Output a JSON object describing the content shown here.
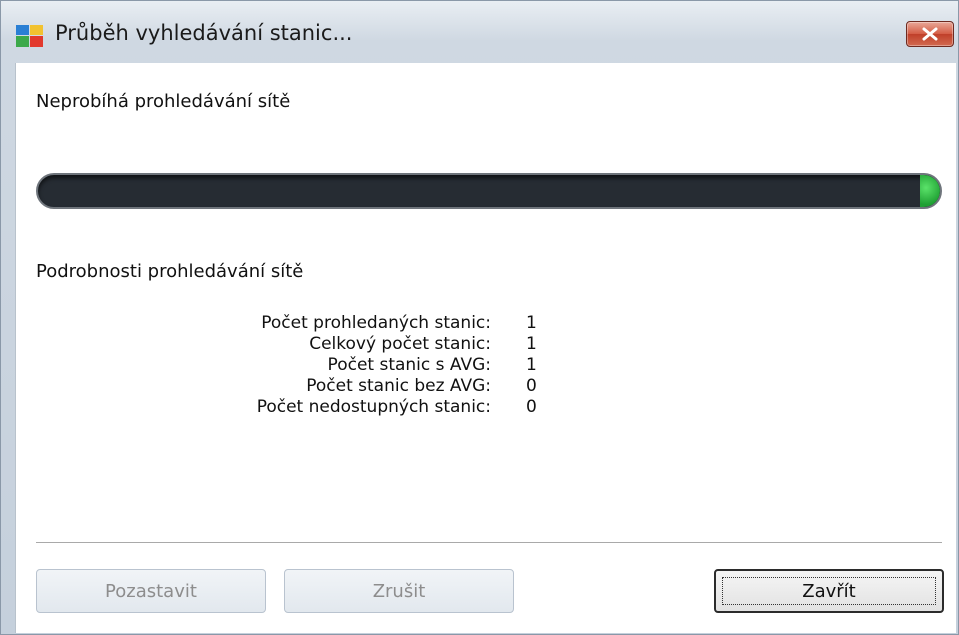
{
  "window": {
    "title": "Průběh vyhledávání stanic...",
    "close_label": "×"
  },
  "status": {
    "text": "Neprobíhá prohledávání sítě",
    "progress_percent": 100
  },
  "details": {
    "title": "Podrobnosti prohledávání sítě",
    "rows": [
      {
        "label": "Počet prohledaných stanic:",
        "value": "1"
      },
      {
        "label": "Celkový počet stanic:",
        "value": "1"
      },
      {
        "label": "Počet stanic s AVG:",
        "value": "1"
      },
      {
        "label": "Počet stanic bez AVG:",
        "value": "0"
      },
      {
        "label": "Počet nedostupných stanic:",
        "value": "0"
      }
    ]
  },
  "buttons": {
    "pause": "Pozastavit",
    "cancel": "Zrušit",
    "close": "Zavřít"
  },
  "colors": {
    "progress_track": "#262c33",
    "progress_fill": "#2fbf45",
    "close_button": "#c9482f"
  }
}
